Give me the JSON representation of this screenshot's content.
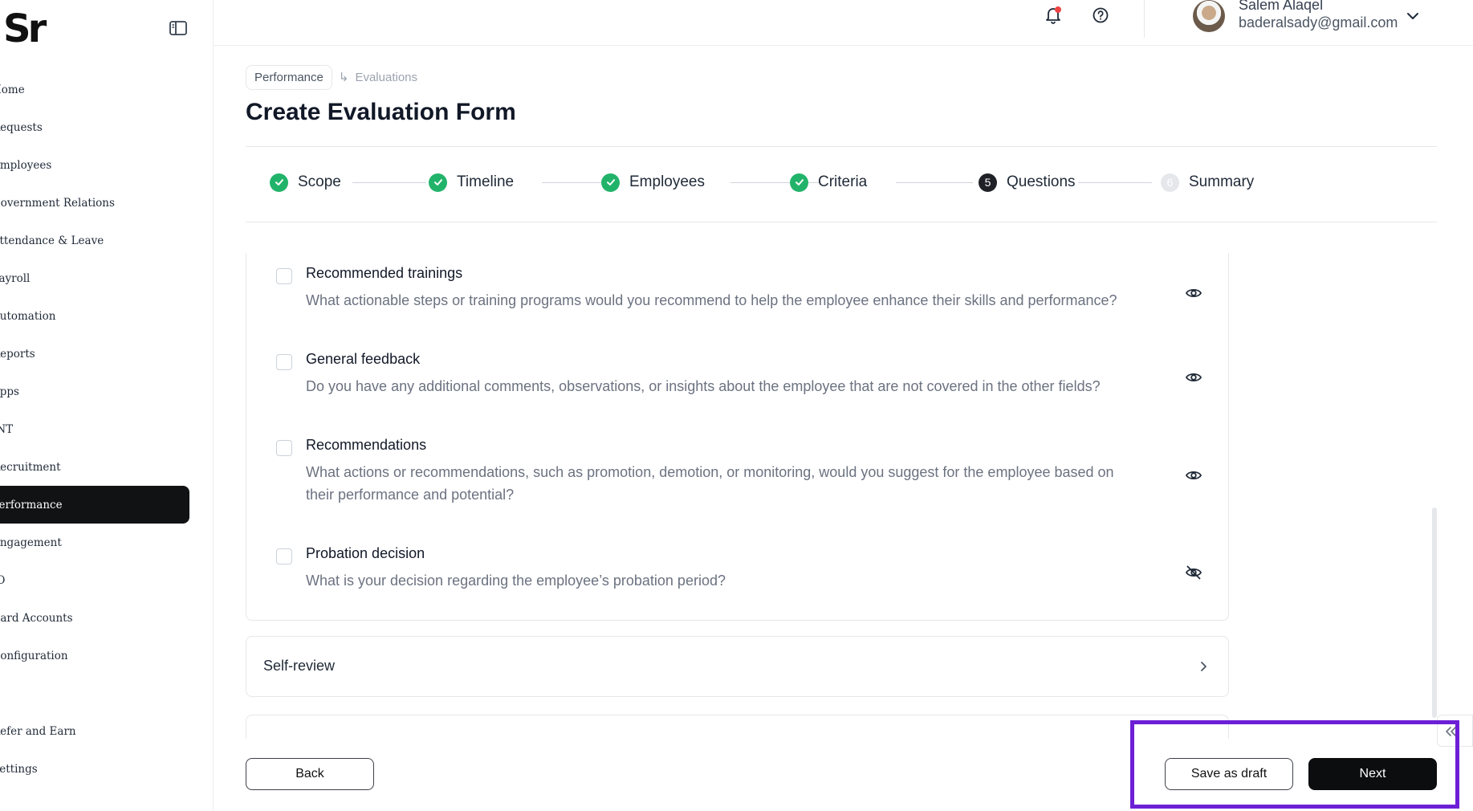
{
  "brand": {
    "logo_text": "Sr"
  },
  "sidebar": {
    "items": [
      {
        "label": "Home",
        "active": false
      },
      {
        "label": "Requests",
        "active": false
      },
      {
        "label": "Employees",
        "active": false
      },
      {
        "label": "Government Relations",
        "active": false
      },
      {
        "label": "Attendance & Leave",
        "active": false
      },
      {
        "label": "Payroll",
        "active": false
      },
      {
        "label": "Automation",
        "active": false
      },
      {
        "label": "Reports",
        "active": false
      },
      {
        "label": "Apps",
        "active": false
      },
      {
        "label": "INT",
        "active": false
      },
      {
        "label": "Recruitment",
        "active": false
      },
      {
        "label": "Performance",
        "active": true
      },
      {
        "label": "Engagement",
        "active": false
      },
      {
        "label": "IO",
        "active": false
      },
      {
        "label": "Card Accounts",
        "active": false
      },
      {
        "label": "Configuration",
        "active": false
      }
    ],
    "bottom_items": [
      {
        "label": "Refer and Earn"
      },
      {
        "label": "Settings"
      }
    ]
  },
  "header": {
    "user_name": "Salem Alaqel",
    "user_email": "baderalsady@gmail.com",
    "has_notification": true
  },
  "breadcrumb": {
    "parent": "Performance",
    "current": "Evaluations"
  },
  "page_title": "Create Evaluation Form",
  "steps": [
    {
      "label": "Scope",
      "status": "done"
    },
    {
      "label": "Timeline",
      "status": "done"
    },
    {
      "label": "Employees",
      "status": "done"
    },
    {
      "label": "Criteria",
      "status": "done"
    },
    {
      "label": "Questions",
      "status": "current",
      "number": "5"
    },
    {
      "label": "Summary",
      "status": "pending",
      "number": "6"
    }
  ],
  "questions": [
    {
      "title": "Recommended trainings",
      "description": "What actionable steps or training programs would you recommend to help the employee enhance their skills and performance?",
      "visible": true
    },
    {
      "title": "General feedback",
      "description": "Do you have any additional comments, observations, or insights about the employee that are not covered in the other fields?",
      "visible": true
    },
    {
      "title": "Recommendations",
      "description": "What actions or recommendations, such as promotion, demotion, or monitoring, would you suggest for the employee based on their performance and potential?",
      "visible": true
    },
    {
      "title": "Probation decision",
      "description": "What is your decision regarding the employee’s probation period?",
      "visible": false
    }
  ],
  "sections": {
    "self_review": "Self-review"
  },
  "footer": {
    "back_label": "Back",
    "draft_label": "Save as draft",
    "next_label": "Next"
  },
  "colors": {
    "accent": "#0c0d0f",
    "success": "#22b36a",
    "highlight": "#6d1fd6",
    "notification": "#ef4444"
  }
}
